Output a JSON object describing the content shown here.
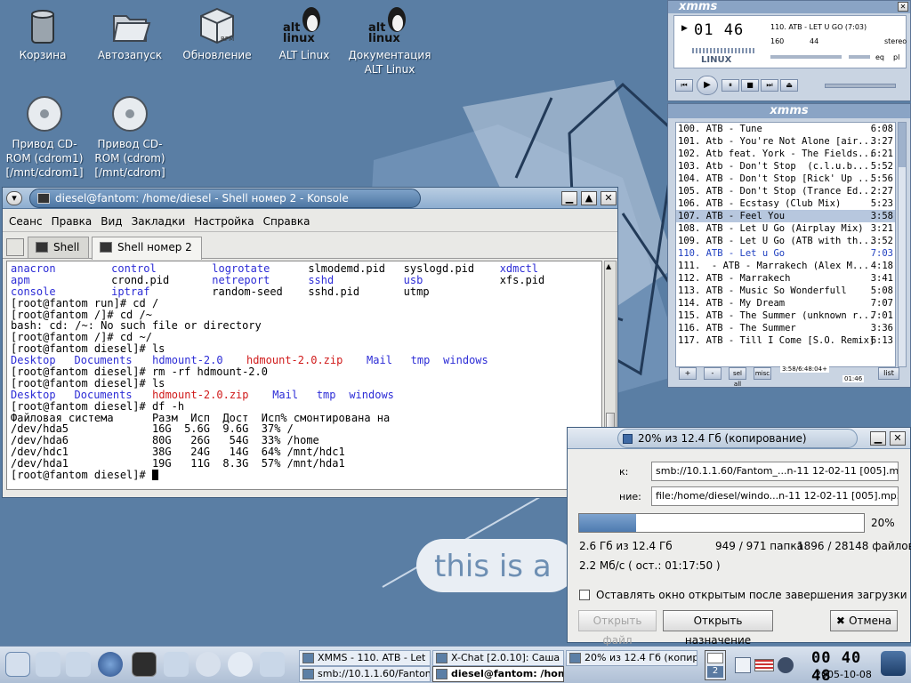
{
  "desktop": {
    "icons": [
      {
        "label": "Корзина"
      },
      {
        "label": "Автозапуск"
      },
      {
        "label": "Обновление"
      },
      {
        "label": "ALT Linux"
      },
      {
        "label": "Документация\nALT Linux"
      },
      {
        "label": "Привод CD-\nROM (cdrom1)\n[/mnt/cdrom1]"
      },
      {
        "label": "Привод CD-\nROM (cdrom)\n[/mnt/cdrom]"
      }
    ],
    "banner_text": "this is a",
    "rpm_badge": "RPM",
    "alt_badge": "alt\nlinux"
  },
  "konsole": {
    "title": "diesel@fantom: /home/diesel - Shell номер 2 - Konsole",
    "menu": [
      "Сеанс",
      "Правка",
      "Вид",
      "Закладки",
      "Настройка",
      "Справка"
    ],
    "tabs": [
      {
        "label": "Shell"
      },
      {
        "label": "Shell номер 2"
      }
    ],
    "ls1": [
      [
        "anacron",
        "control",
        "logrotate",
        "slmodemd.pid",
        "syslogd.pid",
        "xdmctl"
      ],
      [
        "apm",
        "crond.pid",
        "netreport",
        "sshd",
        "usb",
        "xfs.pid"
      ],
      [
        "console",
        "iptraf",
        "random-seed",
        "sshd.pid",
        "utmp",
        ""
      ]
    ],
    "lines": [
      "[root@fantom run]# cd /",
      "[root@fantom /]# cd /~",
      "bash: cd: /~: No such file or directory",
      "[root@fantom /]# cd ~/",
      "[root@fantom diesel]# ls"
    ],
    "ls2": [
      "Desktop",
      "Documents",
      "hdmount-2.0",
      "hdmount-2.0.zip",
      "Mail",
      "tmp",
      "windows"
    ],
    "cmd_rm": "[root@fantom diesel]# rm -rf hdmount-2.0",
    "cmd_ls": "[root@fantom diesel]# ls",
    "ls3": [
      "Desktop",
      "Documents",
      "hdmount-2.0.zip",
      "Mail",
      "tmp",
      "windows"
    ],
    "cmd_df": "[root@fantom diesel]# df -h",
    "df_header": "Файловая система      Разм  Исп  Дост  Исп% смонтирована на",
    "df_rows": [
      "/dev/hda5             16G  5.6G  9.6G  37% /",
      "/dev/hda6             80G   26G   54G  33% /home",
      "/dev/hdc1             38G   24G   14G  64% /mnt/hdc1",
      "/dev/hda1             19G   11G  8.3G  57% /mnt/hda1"
    ],
    "prompt": "[root@fantom diesel]# "
  },
  "xmms_main": {
    "brand": "xmms",
    "time": "01 46",
    "song": "110. ATB - LET U GO (7:03)",
    "bitrate": "160",
    "khz": "44",
    "mode": "stereo",
    "logo": "LINUX",
    "eq": "eq",
    "pl": "pl"
  },
  "xmms_playlist": {
    "brand": "xmms",
    "items": [
      {
        "text": "100. ATB - Tune",
        "len": "6:08"
      },
      {
        "text": "101. Atb - You're Not Alone [air...",
        "len": "3:27"
      },
      {
        "text": "102. Atb feat. York - The Fields...",
        "len": "6:21"
      },
      {
        "text": "103. Atb - Don't Stop  (c.l.u.b...",
        "len": "5:52"
      },
      {
        "text": "104. ATB - Don't Stop [Rick' Up ...",
        "len": "5:56"
      },
      {
        "text": "105. ATB - Don't Stop (Trance Ed...",
        "len": "2:27"
      },
      {
        "text": "106. ATB - Ecstasy (Club Mix)",
        "len": "5:23"
      },
      {
        "text": "107. ATB - Feel You",
        "len": "3:58"
      },
      {
        "text": "108. ATB - Let U Go (Airplay Mix)",
        "len": "3:21"
      },
      {
        "text": "109. ATB - Let U Go (ATB with th...",
        "len": "3:52"
      },
      {
        "text": "110. ATB - Let u Go",
        "len": "7:03"
      },
      {
        "text": "111.  - ATB - Marrakech (Alex M...",
        "len": "4:18"
      },
      {
        "text": "112. ATB - Marrakech",
        "len": "3:41"
      },
      {
        "text": "113. ATB - Music So Wonderfull",
        "len": "5:08"
      },
      {
        "text": "114. ATB - My Dream",
        "len": "7:07"
      },
      {
        "text": "115. ATB - The Summer (unknown r...",
        "len": "7:01"
      },
      {
        "text": "116. ATB - The Summer",
        "len": "3:36"
      },
      {
        "text": "117. ATB - Till I Come [S.O. Remix]",
        "len": "6:13"
      }
    ],
    "selected_index": 7,
    "playing_index": 10,
    "buttons": {
      "add": "+",
      "remove": "-",
      "select": "sel all",
      "misc": "misc",
      "list": "list"
    },
    "info": "3:58/6:48:04+",
    "counter": "01:46"
  },
  "copy_dialog": {
    "title": "20% из 12.4 Гб  (копирование)",
    "from_label": "к:",
    "to_label": "ние:",
    "from_value": "smb://10.1.1.60/Fantom_...n-11 12-02-11 [005].mp3",
    "to_value": "file:/home/diesel/windo...n-11 12-02-11 [005].mp3",
    "progress_fraction": 0.2,
    "percent_text": "20%",
    "size_text": "2.6 Гб из 12.4 Гб",
    "folders_text": "949 / 971 папка",
    "files_text": "1896 / 28148 файлов",
    "speed_text": "2.2 Мб/с ( ост.: 01:17:50 )",
    "keep_open_label": "Оставлять окно открытым после завершения загрузки",
    "open_file_label": "Открыть файл",
    "open_dest_label": "Открыть назначение",
    "cancel_label": "Отмена"
  },
  "taskbar": {
    "tasks_top": [
      {
        "label": "XMMS - 110. ATB - Let"
      },
      {
        "label": "X-Chat [2.0.10]: Саша"
      },
      {
        "label": "20% из 12.4 Гб  (копир"
      }
    ],
    "tasks_bottom": [
      {
        "label": "smb://10.1.1.60/Fanton"
      },
      {
        "label": "diesel@fantom: /hom"
      }
    ],
    "desktop_pager": "2",
    "clock": "00 40 48",
    "date": "2005-10-08"
  }
}
